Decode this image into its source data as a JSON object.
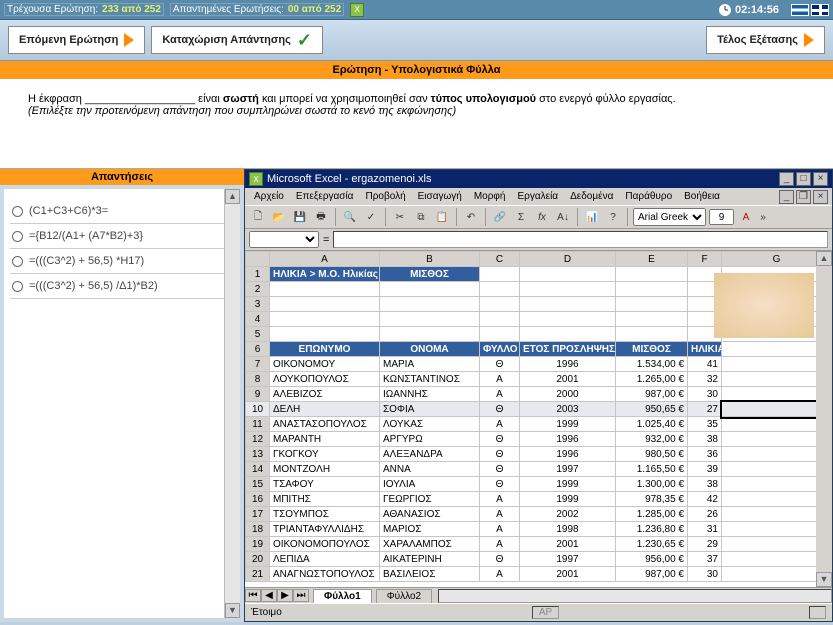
{
  "topbar": {
    "current_label": "Τρέχουσα Ερώτηση:",
    "current_value": "233 από 252",
    "answered_label": "Απαντημένες Ερωτήσεις:",
    "answered_value": "00 από 252",
    "timer": "02:14:56"
  },
  "buttons": {
    "next": "Επόμενη Ερώτηση",
    "submit": "Καταχώριση Απάντησης",
    "end": "Τέλος Εξέτασης"
  },
  "question": {
    "banner": "Ερώτηση - Υπολογιστικά Φύλλα",
    "text1a": "Η έκφραση ",
    "text1b": " είναι ",
    "strong1": "σωστή",
    "text1c": "  και μπορεί να χρησιμοποιηθεί σαν ",
    "strong2": "τύπος υπολογισμού",
    "text1d": " στο ενεργό φύλλο εργασίας.",
    "hint": "(Επιλέξτε την προτεινόμενη απάντηση που συμπληρώνει σωστά το κενό της εκφώνησης)"
  },
  "answers": {
    "title": "Απαντήσεις",
    "items": [
      "(C1+C3+C6)*3=",
      "={B12/(A1+ (A7*B2)+3}",
      "=(((C3^2) + 56,5) *H17)",
      "=(((C3^2) + 56,5) /Δ1)*B2)"
    ]
  },
  "excel": {
    "title": "Microsoft Excel - ergazomenoi.xls",
    "menu": [
      "Αρχείο",
      "Επεξεργασία",
      "Προβολή",
      "Εισαγωγή",
      "Μορφή",
      "Εργαλεία",
      "Δεδομένα",
      "Παράθυρο",
      "Βοήθεια"
    ],
    "font": "Arial Greek",
    "fontsize": "9",
    "cols": [
      "A",
      "B",
      "C",
      "D",
      "E",
      "F",
      "G"
    ],
    "header1": {
      "a": "ΗΛΙΚΙΑ > Μ.Ο. Ηλικίας",
      "b": "ΜΙΣΘΟΣ"
    },
    "header6": {
      "a": "ΕΠΩΝΥΜΟ",
      "b": "ΟΝΟΜΑ",
      "c": "ΦΥΛΛΟ",
      "d": "ΕΤΟΣ ΠΡΟΣΛΗΨΗΣ",
      "e": "ΜΙΣΘΟΣ",
      "f": "ΗΛΙΚΙΑ"
    },
    "rows": [
      {
        "n": 7,
        "a": "ΟΙΚΟΝΟΜΟΥ",
        "b": "ΜΑΡΙΑ",
        "c": "Θ",
        "d": "1996",
        "e": "1.534,00 €",
        "f": "41"
      },
      {
        "n": 8,
        "a": "ΛΟΥΚΟΠΟΥΛΟΣ",
        "b": "ΚΩΝΣΤΑΝΤΙΝΟΣ",
        "c": "Α",
        "d": "2001",
        "e": "1.265,00 €",
        "f": "32"
      },
      {
        "n": 9,
        "a": "ΑΛΕΒΙΖΟΣ",
        "b": "ΙΩΑΝΝΗΣ",
        "c": "Α",
        "d": "2000",
        "e": "987,00 €",
        "f": "30"
      },
      {
        "n": 10,
        "a": "ΔΕΛΗ",
        "b": "ΣΟΦΙΑ",
        "c": "Θ",
        "d": "2003",
        "e": "950,65 €",
        "f": "27",
        "sel": true
      },
      {
        "n": 11,
        "a": "ΑΝΑΣΤΑΣΟΠΟΥΛΟΣ",
        "b": "ΛΟΥΚΑΣ",
        "c": "Α",
        "d": "1999",
        "e": "1.025,40 €",
        "f": "35"
      },
      {
        "n": 12,
        "a": "ΜΑΡΑΝΤΗ",
        "b": "ΑΡΓΥΡΩ",
        "c": "Θ",
        "d": "1996",
        "e": "932,00 €",
        "f": "38"
      },
      {
        "n": 13,
        "a": "ΓΚΟΓΚΟΥ",
        "b": "ΑΛΕΞΑΝΔΡΑ",
        "c": "Θ",
        "d": "1996",
        "e": "980,50 €",
        "f": "36"
      },
      {
        "n": 14,
        "a": "ΜΟΝΤΖΟΛΗ",
        "b": "ΑΝΝΑ",
        "c": "Θ",
        "d": "1997",
        "e": "1.165,50 €",
        "f": "39"
      },
      {
        "n": 15,
        "a": "ΤΣΑΦΟΥ",
        "b": "ΙΟΥΛΙΑ",
        "c": "Θ",
        "d": "1999",
        "e": "1.300,00 €",
        "f": "38"
      },
      {
        "n": 16,
        "a": "ΜΠΙΤΗΣ",
        "b": "ΓΕΩΡΓΙΟΣ",
        "c": "Α",
        "d": "1999",
        "e": "978,35 €",
        "f": "42"
      },
      {
        "n": 17,
        "a": "ΤΣΟΥΜΠΟΣ",
        "b": "ΑΘΑΝΑΣΙΟΣ",
        "c": "Α",
        "d": "2002",
        "e": "1.285,00 €",
        "f": "26"
      },
      {
        "n": 18,
        "a": "ΤΡΙΑΝΤΑΦΥΛΛΙΔΗΣ",
        "b": "ΜΑΡΙΟΣ",
        "c": "Α",
        "d": "1998",
        "e": "1.236,80 €",
        "f": "31"
      },
      {
        "n": 19,
        "a": "ΟΙΚΟΝΟΜΟΠΟΥΛΟΣ",
        "b": "ΧΑΡΑΛΑΜΠΟΣ",
        "c": "Α",
        "d": "2001",
        "e": "1.230,65 €",
        "f": "29"
      },
      {
        "n": 20,
        "a": "ΛΕΠΙΔΑ",
        "b": "ΑΙΚΑΤΕΡΙΝΗ",
        "c": "Θ",
        "d": "1997",
        "e": "956,00 €",
        "f": "37"
      },
      {
        "n": 21,
        "a": "ΑΝΑΓΝΩΣΤΟΠΟΥΛΟΣ",
        "b": "ΒΑΣΙΛΕΙΟΣ",
        "c": "Α",
        "d": "2001",
        "e": "987,00 €",
        "f": "30"
      }
    ],
    "sheet_tabs": [
      "Φύλλο1",
      "Φύλλο2"
    ],
    "status": "Έτοιμο",
    "caps": "ΑΡ"
  }
}
